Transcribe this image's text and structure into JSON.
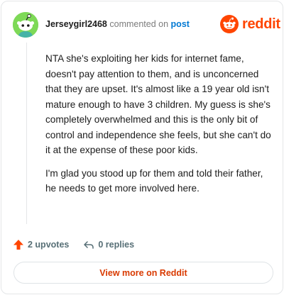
{
  "header": {
    "username": "Jerseygirl2468",
    "commented_text": "commented on",
    "post_link": "post",
    "logo_text": "reddit"
  },
  "comment": {
    "paragraphs": [
      "NTA she's exploiting her kids for internet fame, doesn't pay attention to them, and is unconcerned that they are upset. It's almost like a 19 year old isn't mature enough to have 3 children. My guess is she's completely overwhelmed and this is the only bit of control and independence she feels, but she can't do it at the expense of these poor kids.",
      "I'm glad you stood up for them and told their father, he needs to get more involved here."
    ]
  },
  "actions": {
    "upvotes": "2 upvotes",
    "replies": "0 replies"
  },
  "view_more_label": "View more on Reddit",
  "colors": {
    "brand": "#ff4500",
    "avatar_bg": "#7ed957",
    "upvote": "#ff4500",
    "link": "#0079d3",
    "view_more": "#d93a00"
  },
  "icons": {
    "avatar": "snoo-avatar-icon",
    "logo": "reddit-logo-icon",
    "upvote": "upvote-arrow-icon",
    "reply": "reply-arrow-icon"
  }
}
